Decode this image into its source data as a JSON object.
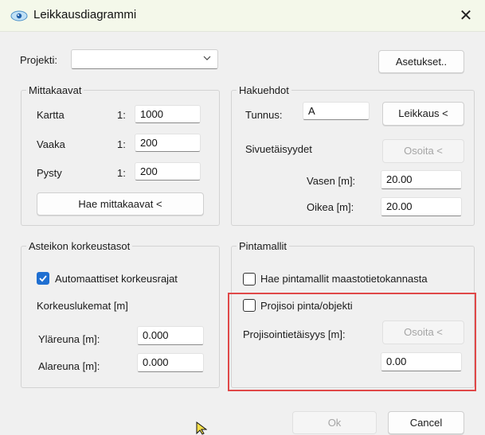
{
  "window": {
    "title": "Leikkausdiagrammi",
    "close_glyph": "✕",
    "app_icon": "eye-icon"
  },
  "project": {
    "label": "Projekti:",
    "value": "",
    "settings_button": "Asetukset.."
  },
  "scales": {
    "legend": "Mittakaavat",
    "map_label": "Kartta",
    "map_prefix": "1:",
    "map_value": "1000",
    "horizontal_label": "Vaaka",
    "horizontal_prefix": "1:",
    "horizontal_value": "200",
    "vertical_label": "Pysty",
    "vertical_prefix": "1:",
    "vertical_value": "200",
    "fetch_button": "Hae mittakaavat <"
  },
  "search": {
    "legend": "Hakuehdot",
    "id_label": "Tunnus:",
    "id_value": "A",
    "section_button": "Leikkaus <",
    "side_distances_label": "Sivuetäisyydet",
    "point_button": "Osoita <",
    "left_label": "Vasen [m]:",
    "left_value": "20.00",
    "right_label": "Oikea [m]:",
    "right_value": "20.00"
  },
  "elevation": {
    "legend": "Asteikon  korkeustasot",
    "auto_label": "Automaattiset korkeusrajat",
    "auto_checked": true,
    "readings_label": "Korkeuslukemat [m]",
    "top_label": "Yläreuna [m]:",
    "top_value": "0.000",
    "bottom_label": "Alareuna [m]:",
    "bottom_value": "0.000"
  },
  "surfaces": {
    "legend": "Pintamallit",
    "fetch_label": "Hae pintamallit maastotietokannasta",
    "fetch_checked": false,
    "project_label": "Projisoi pinta/objekti",
    "project_checked": false,
    "distance_label": "Projisointietäisyys [m]:",
    "point_button": "Osoita <",
    "distance_value": "0.00"
  },
  "footer": {
    "ok_button": "Ok",
    "cancel_button": "Cancel"
  },
  "colors": {
    "highlight_box": "#e04848",
    "checkbox_accent": "#1f6fd1",
    "titlebar": "#f4f8ea"
  }
}
